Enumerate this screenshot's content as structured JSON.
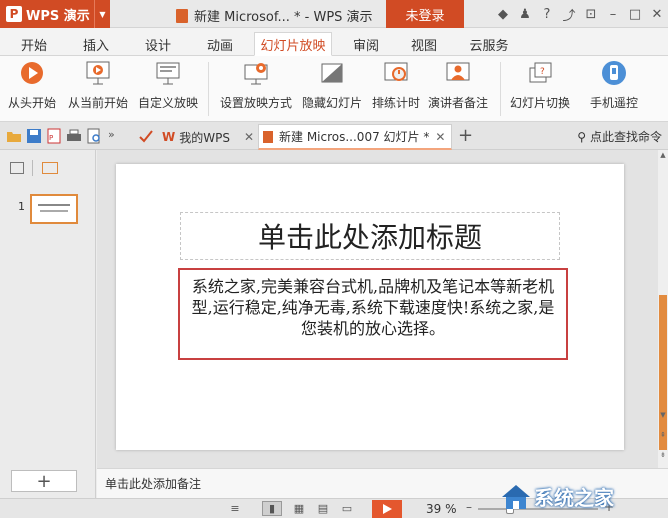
{
  "titlebar": {
    "app_name": "WPS 演示",
    "app_logo_letter": "P",
    "document_title": "新建 Microsof... * - WPS 演示",
    "login_label": "未登录"
  },
  "menu": {
    "tabs": [
      "开始",
      "插入",
      "设计",
      "动画",
      "幻灯片放映",
      "审阅",
      "视图",
      "云服务"
    ],
    "active": "幻灯片放映"
  },
  "ribbon": {
    "buttons": [
      {
        "label": "从头开始",
        "icon": "play-circle-icon"
      },
      {
        "label": "从当前开始",
        "icon": "play-current-icon"
      },
      {
        "label": "自定义放映",
        "icon": "custom-show-icon"
      },
      {
        "label": "设置放映方式",
        "icon": "setup-show-icon"
      },
      {
        "label": "隐藏幻灯片",
        "icon": "hide-slide-icon"
      },
      {
        "label": "排练计时",
        "icon": "rehearse-timing-icon"
      },
      {
        "label": "演讲者备注",
        "icon": "speaker-notes-icon"
      },
      {
        "label": "幻灯片切换",
        "icon": "slide-transition-icon"
      },
      {
        "label": "手机遥控",
        "icon": "phone-remote-icon"
      }
    ]
  },
  "doctabs": {
    "tab1": "我的WPS",
    "tab2": "新建 Micros...007 幻灯片 *",
    "find_label": "点此查找命令",
    "tab1_logo": "W"
  },
  "leftpanel": {
    "slide_number": "1"
  },
  "slide": {
    "title_placeholder": "单击此处添加标题",
    "body_text": "系统之家,完美兼容台式机,品牌机及笔记本等新老机型,运行稳定,纯净无毒,系统下载速度快!系统之家,是您装机的放心选择。"
  },
  "notes": {
    "placeholder": "单击此处添加备注"
  },
  "statusbar": {
    "zoom_percent": "39 %"
  },
  "watermark": {
    "text": "系统之家"
  },
  "colors": {
    "accent": "#d14b24",
    "selection_border": "#c84040",
    "thumbnail_border": "#e08a3c",
    "play_button": "#e4572e"
  }
}
